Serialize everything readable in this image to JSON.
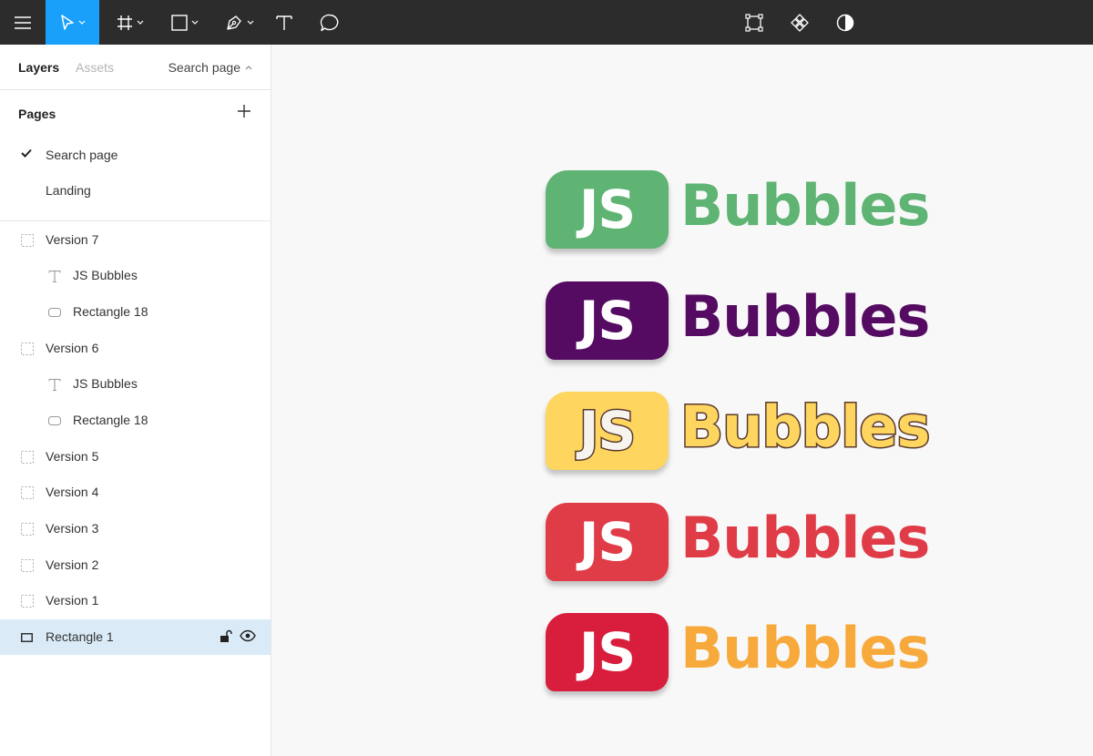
{
  "toolbar": {
    "menu_icon": "hamburger-icon",
    "tools": [
      "move-tool",
      "frame-tool",
      "shape-tool",
      "pen-tool",
      "text-tool",
      "comment-tool"
    ],
    "right_tools": [
      "component-edit-icon",
      "components-icon",
      "contrast-icon"
    ],
    "accent": "#18a0fb"
  },
  "panel": {
    "tabs": {
      "layers": "Layers",
      "assets": "Assets"
    },
    "current_page": "Search page",
    "pages_title": "Pages",
    "pages": [
      {
        "label": "Search page",
        "checked": true
      },
      {
        "label": "Landing",
        "checked": false
      }
    ],
    "layers": [
      {
        "label": "Version 7",
        "type": "frame"
      },
      {
        "label": "JS Bubbles",
        "type": "text"
      },
      {
        "label": "Rectangle 18",
        "type": "rect"
      },
      {
        "label": "Version 6",
        "type": "frame"
      },
      {
        "label": "JS Bubbles",
        "type": "text"
      },
      {
        "label": "Rectangle 18",
        "type": "rect"
      },
      {
        "label": "Version 5",
        "type": "frame"
      },
      {
        "label": "Version 4",
        "type": "frame"
      },
      {
        "label": "Version 3",
        "type": "frame"
      },
      {
        "label": "Version 2",
        "type": "frame"
      },
      {
        "label": "Version 1",
        "type": "frame"
      },
      {
        "label": "Rectangle 1",
        "type": "rect",
        "selected": true
      }
    ]
  },
  "canvas": {
    "logos": [
      {
        "badge": "JS",
        "word": "Bubbles",
        "badge_color": "#5fb474",
        "word_color": "#5fb474"
      },
      {
        "badge": "JS",
        "word": "Bubbles",
        "badge_color": "#560b62",
        "word_color": "#560b62"
      },
      {
        "badge": "JS",
        "word": "Bubbles",
        "badge_color": "#fdd55f",
        "word_color": "#fdd55f",
        "outline": "#5a3a2e"
      },
      {
        "badge": "JS",
        "word": "Bubbles",
        "badge_color": "#e03c48",
        "word_color": "#e03c48"
      },
      {
        "badge": "JS",
        "word": "Bubbles",
        "badge_color": "#d81e3c",
        "word_color": "#f7a93b"
      }
    ]
  }
}
